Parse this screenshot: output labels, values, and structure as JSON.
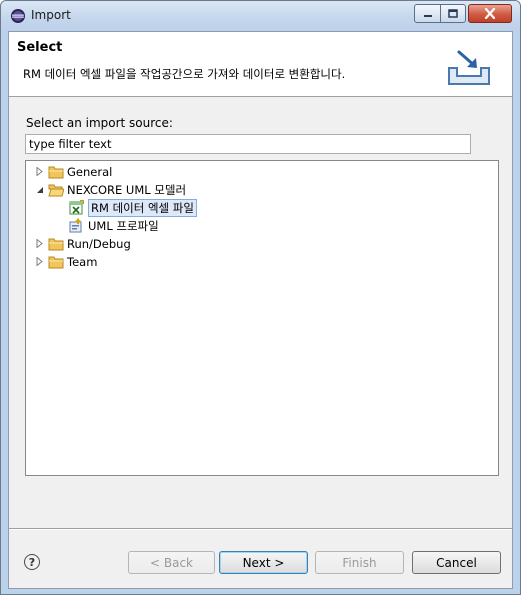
{
  "window": {
    "title": "Import",
    "icon": "eclipse-icon"
  },
  "header": {
    "title": "Select",
    "description": "RM  데이터 엑셀 파일을 작업공간으로 가져와 데이터로 변환합니다.",
    "icon": "import-tray-icon"
  },
  "source": {
    "label": "Select an import source:",
    "filter_value": "type filter text"
  },
  "tree": {
    "items": [
      {
        "label": "General",
        "icon": "folder-icon",
        "expanded": false
      },
      {
        "label": "NEXCORE UML 모델러",
        "icon": "folder-icon",
        "expanded": true
      },
      {
        "label": "RM 데이터 엑셀 파일",
        "icon": "excel-import-icon",
        "selected": true
      },
      {
        "label": "UML 프로파일",
        "icon": "uml-profile-icon"
      },
      {
        "label": "Run/Debug",
        "icon": "folder-icon",
        "expanded": false
      },
      {
        "label": "Team",
        "icon": "folder-icon",
        "expanded": false
      }
    ]
  },
  "buttons": {
    "help": "?",
    "back": "< Back",
    "next": "Next >",
    "finish": "Finish",
    "cancel": "Cancel"
  }
}
